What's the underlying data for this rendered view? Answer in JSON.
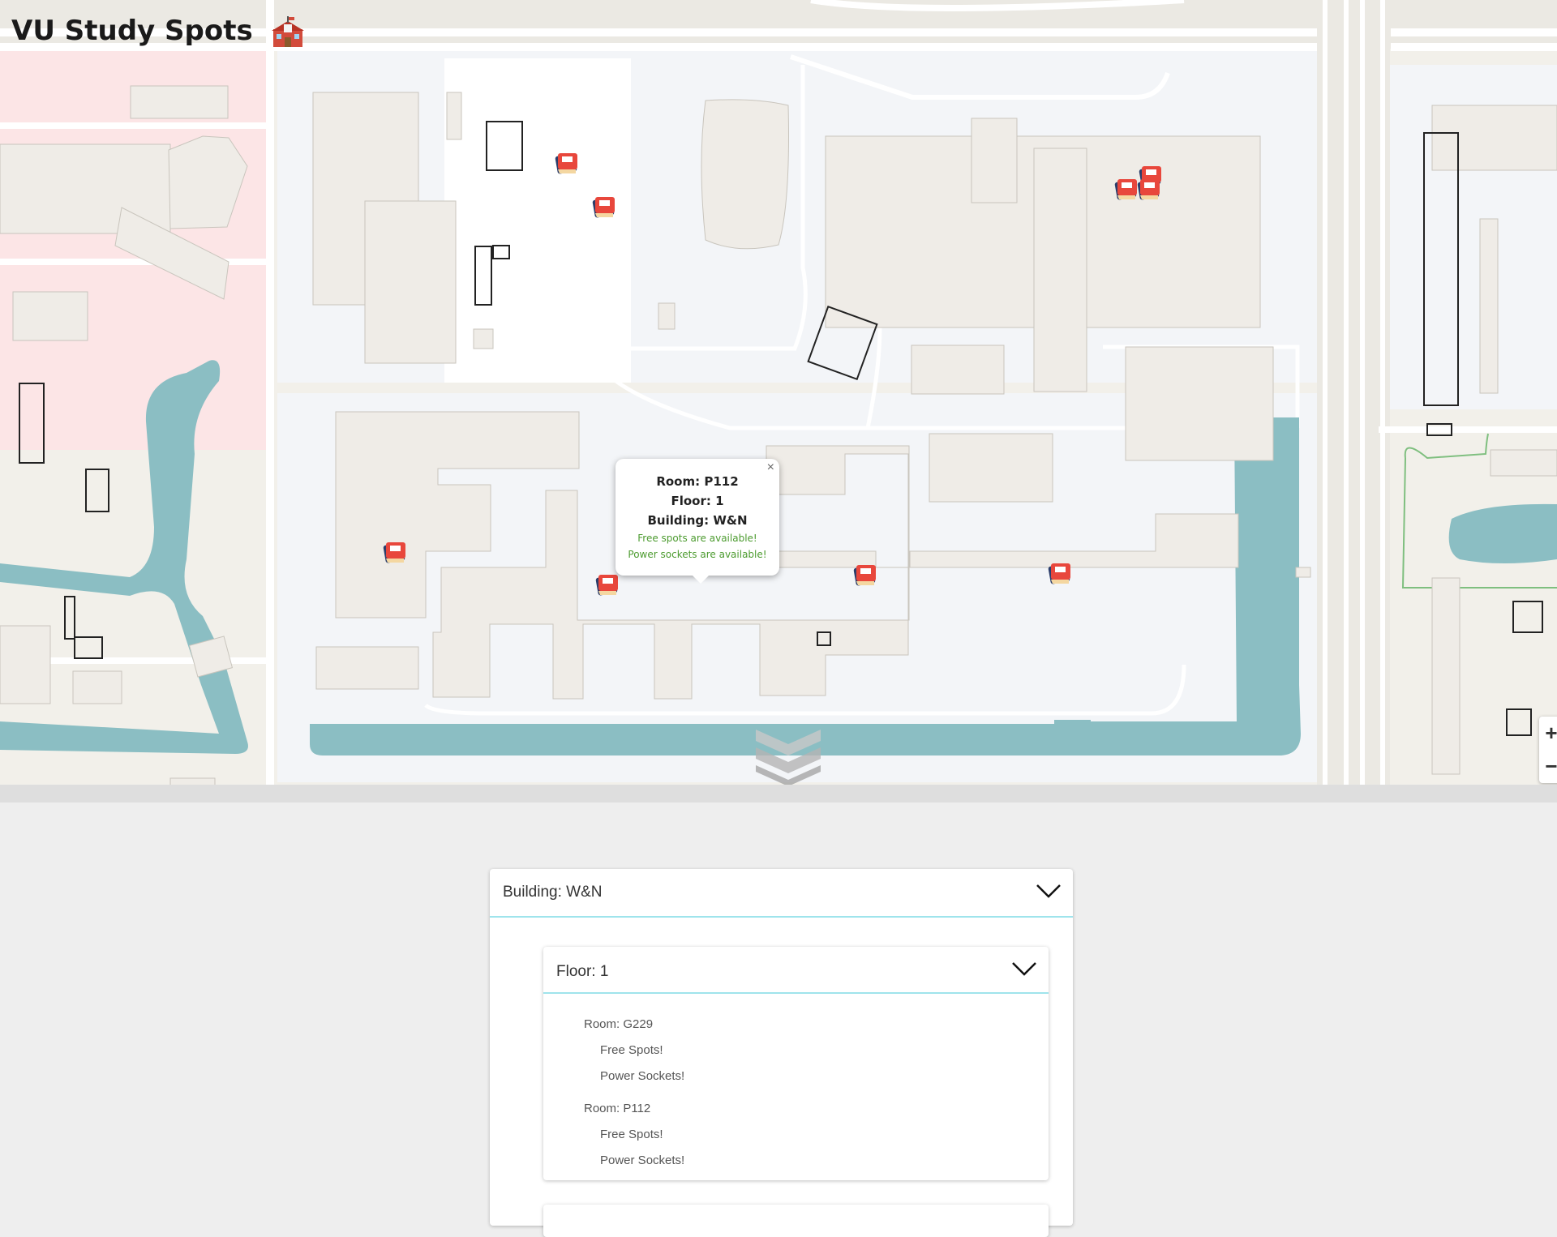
{
  "app": {
    "title": "VU Study Spots",
    "title_icon": "school-icon"
  },
  "map": {
    "popup": {
      "room": "Room: P112",
      "floor": "Floor: 1",
      "building": "Building: W&N",
      "free": "Free spots are available!",
      "power": "Power sockets are available!",
      "close": "×"
    },
    "zoom_in": "+",
    "zoom_out": "−",
    "marker_icon": "books-icon",
    "colors": {
      "water": "#8bbec3",
      "residential": "#fce5e6",
      "land": "#f2f0ea",
      "campus": "#f3f5f8",
      "popup_text_green": "#4c9b2f"
    }
  },
  "list": {
    "building": {
      "label": "Building: W&N"
    },
    "floor": {
      "label": "Floor: 1"
    },
    "rooms": [
      {
        "name": "Room: G229",
        "free": "Free Spots!",
        "power": "Power Sockets!"
      },
      {
        "name": "Room: P112",
        "free": "Free Spots!",
        "power": "Power Sockets!"
      }
    ],
    "accent": "#9fe4ec"
  }
}
